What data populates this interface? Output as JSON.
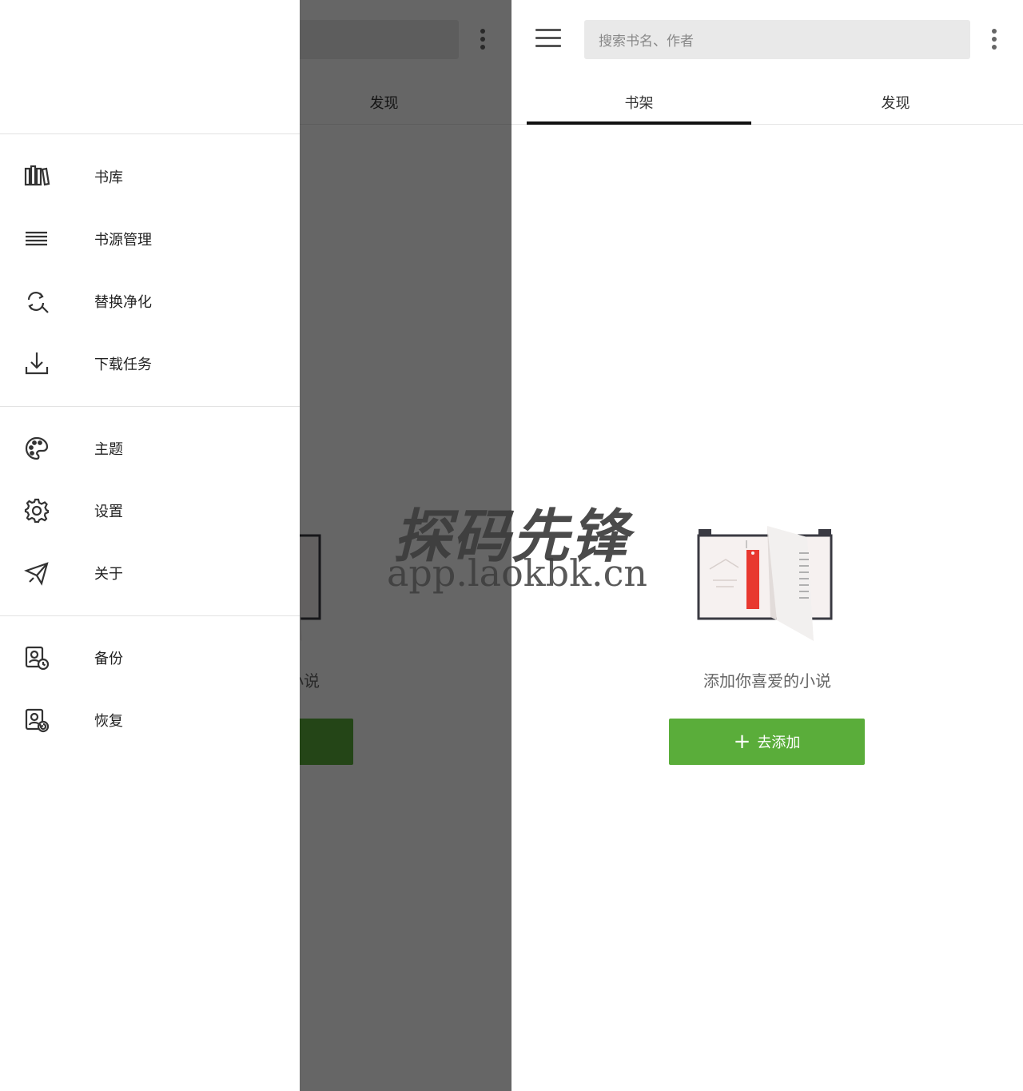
{
  "search": {
    "placeholder": "搜索书名、作者"
  },
  "tabs": [
    {
      "label": "书架"
    },
    {
      "label": "发现"
    }
  ],
  "empty": {
    "message": "添加你喜爱的小说",
    "add_button": "去添加",
    "add_icon": "+"
  },
  "drawer": {
    "groups": [
      [
        {
          "icon": "bookshelf-icon",
          "label": "书库"
        },
        {
          "icon": "list-icon",
          "label": "书源管理"
        },
        {
          "icon": "replace-search-icon",
          "label": "替换净化"
        },
        {
          "icon": "download-icon",
          "label": "下载任务"
        }
      ],
      [
        {
          "icon": "palette-icon",
          "label": "主题"
        },
        {
          "icon": "gear-icon",
          "label": "设置"
        },
        {
          "icon": "send-icon",
          "label": "关于"
        }
      ],
      [
        {
          "icon": "backup-icon",
          "label": "备份"
        },
        {
          "icon": "restore-icon",
          "label": "恢复"
        }
      ]
    ]
  },
  "watermark": {
    "title": "探码先锋",
    "url": "app.laokbk.cn"
  },
  "colors": {
    "accent_green": "#5aad3a",
    "scrim": "rgba(0,0,0,0.6)"
  }
}
